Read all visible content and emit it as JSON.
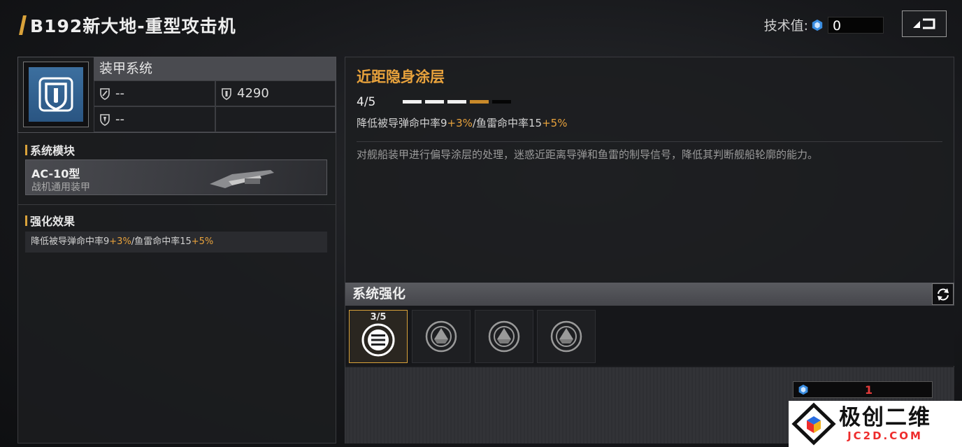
{
  "header": {
    "title": "B192新大地-重型攻击机",
    "tech_label": "技术值:",
    "tech_value": "0",
    "back_icon": "return-arrow-icon"
  },
  "armor": {
    "label": "装甲系统",
    "stat1": "--",
    "stat2": "4290",
    "stat3": "--"
  },
  "module": {
    "section_title": "系统模块",
    "name": "AC-10型",
    "subtitle": "战机通用装甲"
  },
  "effect": {
    "section_title": "强化效果",
    "text_a": "降低被导弹命中率9",
    "bonus_a": "+3%",
    "text_b": "/鱼雷命中率15",
    "bonus_b": "+5%"
  },
  "skill": {
    "title": "近距隐身涂层",
    "level": "4/5",
    "level_filled": 4,
    "level_max": 5,
    "effect_a": "降低被导弹命中率9",
    "bonus_a": "+3%",
    "effect_b": "/鱼雷命中率15",
    "bonus_b": "+5%",
    "description": "对舰船装甲进行偏导涂层的处理，迷惑近距离导弹和鱼雷的制导信号，降低其判断舰船轮廓的能力。"
  },
  "enhance": {
    "label": "系统强化",
    "active_slot_count": "3/5"
  },
  "cost": {
    "value": "1"
  },
  "watermark": {
    "name": "极创二维",
    "domain": "JC2D.COM"
  },
  "colors": {
    "accent": "#d9a23a",
    "bonus": "#e8a23c",
    "armor_icon": "#3c6f9f",
    "cost_red": "#e23a3a"
  }
}
